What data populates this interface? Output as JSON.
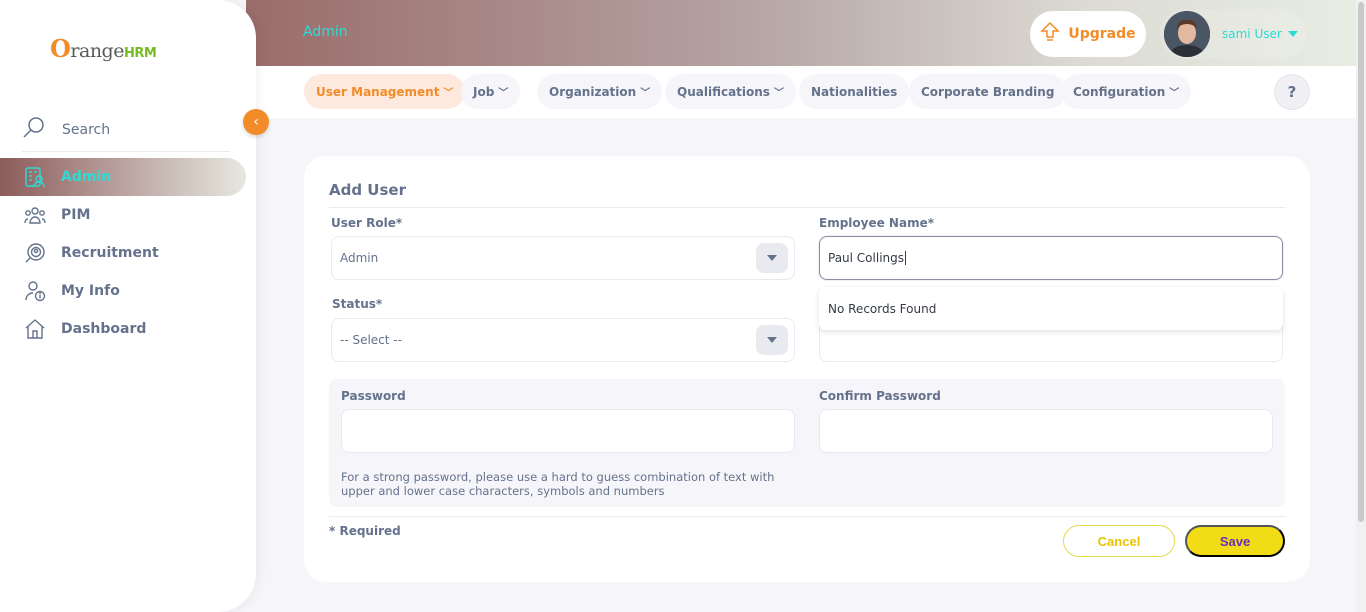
{
  "brand": {
    "name_o": "O",
    "name_rest": "range",
    "name_hrm": "HRM"
  },
  "sidebar": {
    "search_label": "Search",
    "collapse_symbol": "‹",
    "items": [
      {
        "label": "Admin",
        "icon": "admin-icon",
        "active": true
      },
      {
        "label": "PIM",
        "icon": "pim-icon"
      },
      {
        "label": "Recruitment",
        "icon": "recruitment-icon"
      },
      {
        "label": "My Info",
        "icon": "my-info-icon"
      },
      {
        "label": "Dashboard",
        "icon": "dashboard-icon"
      }
    ]
  },
  "header": {
    "module_title": "Admin",
    "upgrade_label": "Upgrade",
    "user_name": "sami User"
  },
  "subnav": {
    "tabs": [
      {
        "label": "User Management",
        "has_dropdown": true,
        "active": true
      },
      {
        "label": "Job",
        "has_dropdown": true
      },
      {
        "label": "Organization",
        "has_dropdown": true
      },
      {
        "label": "Qualifications",
        "has_dropdown": true
      },
      {
        "label": "Nationalities",
        "has_dropdown": false
      },
      {
        "label": "Corporate Branding",
        "has_dropdown": false
      },
      {
        "label": "Configuration",
        "has_dropdown": true
      }
    ],
    "help_label": "?"
  },
  "form": {
    "title": "Add User",
    "user_role": {
      "label": "User Role*",
      "value": "Admin"
    },
    "employee_name": {
      "label": "Employee Name*",
      "value": "Paul Collings"
    },
    "autocomplete": {
      "message": "No Records Found"
    },
    "status": {
      "label": "Status*",
      "value": "-- Select --"
    },
    "password": {
      "label": "Password",
      "value": ""
    },
    "confirm_password": {
      "label": "Confirm Password",
      "value": ""
    },
    "password_hint": "For a strong password, please use a hard to guess combination of text with upper and lower case characters, symbols and numbers",
    "required_note": "* Required",
    "cancel_label": "Cancel",
    "save_label": "Save"
  },
  "colors": {
    "accent_orange": "#f28c28",
    "teal_text": "#2ddbd4",
    "save_yellow": "#f2dc15",
    "text_gray": "#64728c"
  }
}
